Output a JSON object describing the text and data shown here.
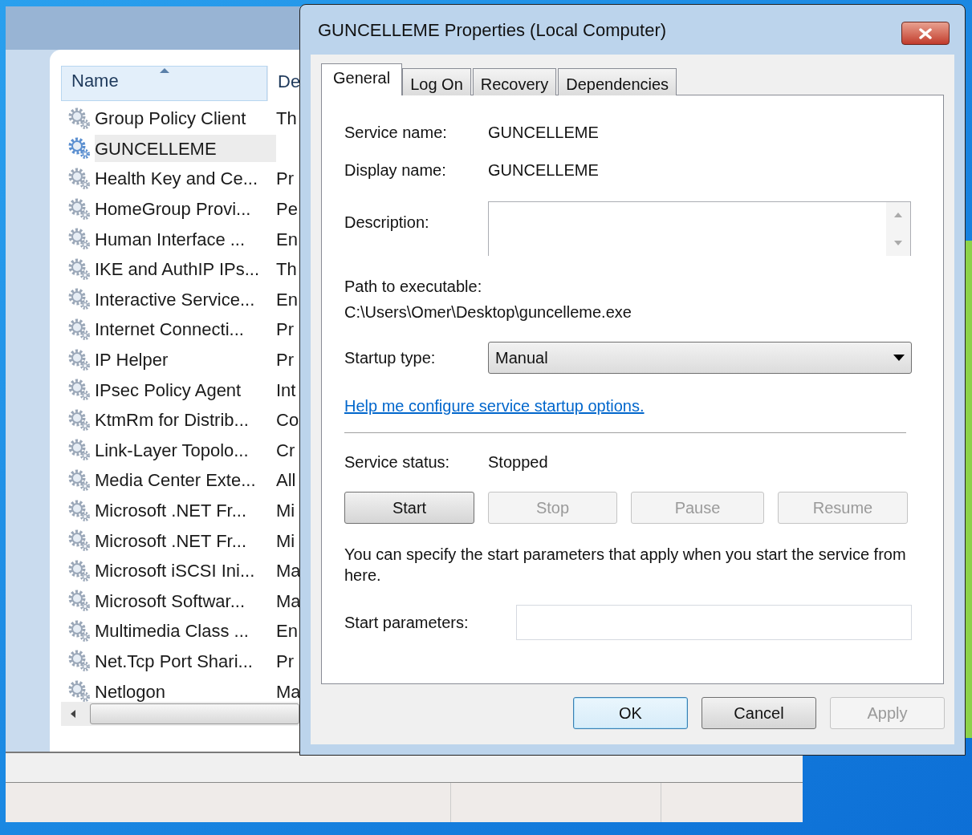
{
  "services_window": {
    "columns": [
      {
        "label": "Name",
        "sorted": true
      },
      {
        "label": "De",
        "sorted": false
      }
    ],
    "rows": [
      {
        "name": "Group Policy Client",
        "description": "Th",
        "selected": false
      },
      {
        "name": "GUNCELLEME",
        "selected": true
      },
      {
        "name": "Health Key and Ce...",
        "description": "Pr",
        "selected": false
      },
      {
        "name": "HomeGroup Provi...",
        "description": "Pe",
        "selected": false
      },
      {
        "name": "Human Interface ...",
        "description": "En",
        "selected": false
      },
      {
        "name": "IKE and AuthIP IPs...",
        "description": "Th",
        "selected": false
      },
      {
        "name": "Interactive Service...",
        "description": "En",
        "selected": false
      },
      {
        "name": "Internet Connecti...",
        "description": "Pr",
        "selected": false
      },
      {
        "name": "IP Helper",
        "description": "Pr",
        "selected": false
      },
      {
        "name": "IPsec Policy Agent",
        "description": "Int",
        "selected": false
      },
      {
        "name": "KtmRm for Distrib...",
        "description": "Co",
        "selected": false
      },
      {
        "name": "Link-Layer Topolo...",
        "description": "Cr",
        "selected": false
      },
      {
        "name": "Media Center Exte...",
        "description": "All",
        "selected": false
      },
      {
        "name": "Microsoft .NET Fr...",
        "description": "Mi",
        "selected": false
      },
      {
        "name": "Microsoft .NET Fr...",
        "description": "Mi",
        "selected": false
      },
      {
        "name": "Microsoft iSCSI Ini...",
        "description": "Ma",
        "selected": false
      },
      {
        "name": "Microsoft Softwar...",
        "description": "Ma",
        "selected": false
      },
      {
        "name": "Multimedia Class ...",
        "description": "En",
        "selected": false
      },
      {
        "name": "Net.Tcp Port Shari...",
        "description": "Pr",
        "selected": false
      },
      {
        "name": "Netlogon",
        "description": "Ma",
        "selected": false
      }
    ]
  },
  "dialog": {
    "title": "GUNCELLEME Properties (Local Computer)",
    "tabs": [
      {
        "label": "General",
        "selected": true
      },
      {
        "label": "Log On",
        "selected": false
      },
      {
        "label": "Recovery",
        "selected": false
      },
      {
        "label": "Dependencies",
        "selected": false
      }
    ],
    "service_name": {
      "label": "Service name:",
      "value": "GUNCELLEME"
    },
    "display_name": {
      "label": "Display name:",
      "value": "GUNCELLEME"
    },
    "description": {
      "label": "Description:"
    },
    "path": {
      "label": "Path to executable:",
      "value": "C:\\Users\\Omer\\Desktop\\guncelleme.exe"
    },
    "startup_type": {
      "label": "Startup type:",
      "value": "Manual"
    },
    "help_link": "Help me configure service startup options.",
    "service_status": {
      "label": "Service status:",
      "value": "Stopped"
    },
    "control_buttons": [
      {
        "label": "Start",
        "disabled": false
      },
      {
        "label": "Stop",
        "disabled": true
      },
      {
        "label": "Pause",
        "disabled": true
      },
      {
        "label": "Resume",
        "disabled": true
      }
    ],
    "note": "You can specify the start parameters that apply when you start the service from here.",
    "start_parameters": {
      "label": "Start parameters:"
    },
    "buttons": [
      {
        "label": "OK",
        "default": true,
        "disabled": false
      },
      {
        "label": "Cancel",
        "default": false,
        "disabled": false
      },
      {
        "label": "Apply",
        "default": false,
        "disabled": true
      }
    ]
  }
}
